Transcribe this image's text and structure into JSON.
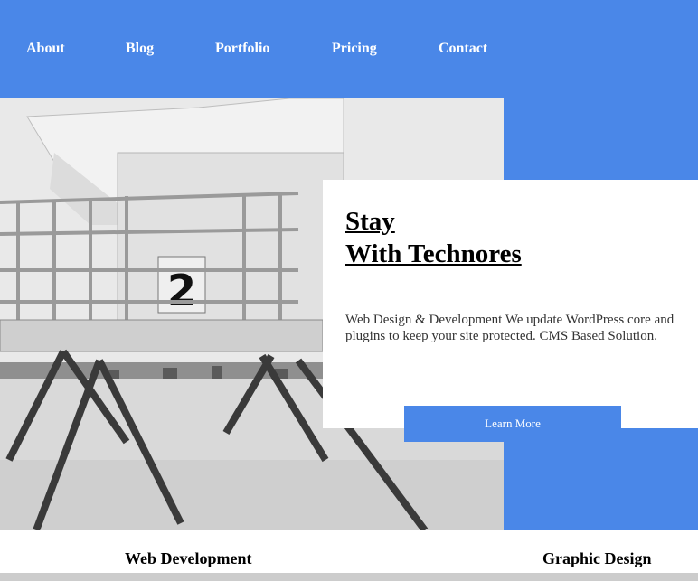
{
  "nav": {
    "items": [
      {
        "label": "About"
      },
      {
        "label": "Blog"
      },
      {
        "label": "Portfolio"
      },
      {
        "label": "Pricing"
      },
      {
        "label": "Contact"
      }
    ]
  },
  "hero": {
    "title_line1": "Stay",
    "title_line2": "With Technores",
    "description": "Web Design & Development We update WordPress core and plugins to keep your site protected. CMS Based Solution.",
    "button_label": "Learn More",
    "image_text": "2"
  },
  "services": [
    {
      "label": "Web Development"
    },
    {
      "label": "Graphic Design"
    }
  ],
  "colors": {
    "accent": "#4a87e8",
    "background": "#ffffff",
    "text": "#000000"
  }
}
